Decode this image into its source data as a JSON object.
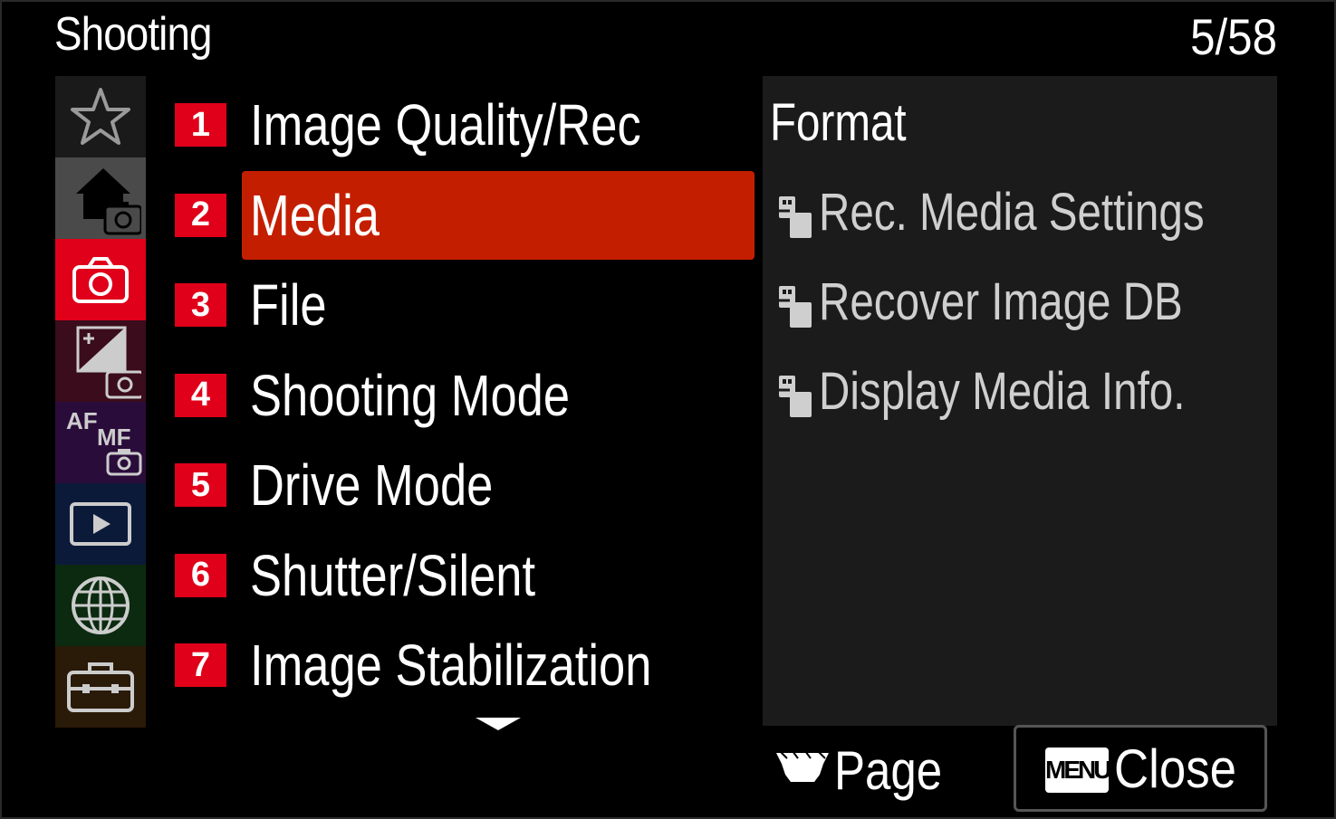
{
  "header": {
    "title": "Shooting",
    "page_indicator": "5/58"
  },
  "sidebar": {
    "categories": [
      {
        "name": "my-menu",
        "icon": "star-icon",
        "bg": "#1a1a1a"
      },
      {
        "name": "main-shooting",
        "icon": "home-camera-icon",
        "bg": "#4a4a4a"
      },
      {
        "name": "shooting",
        "icon": "camera-icon",
        "bg": "#e0001a",
        "selected": true
      },
      {
        "name": "exposure-color",
        "icon": "exposure-camera-icon",
        "bg": "#3a0c1c"
      },
      {
        "name": "focus",
        "icon": "af-mf-camera-icon",
        "bg": "#2a0c3a",
        "text_af": "AF",
        "text_mf": "MF"
      },
      {
        "name": "playback",
        "icon": "playback-icon",
        "bg": "#0c1a3a"
      },
      {
        "name": "network",
        "icon": "globe-icon",
        "bg": "#0c2a10"
      },
      {
        "name": "setup",
        "icon": "toolbox-icon",
        "bg": "#2a1a08"
      }
    ]
  },
  "menu": {
    "items": [
      {
        "number": "1",
        "label": "Image Quality/Rec"
      },
      {
        "number": "2",
        "label": "Media",
        "selected": true
      },
      {
        "number": "3",
        "label": "File"
      },
      {
        "number": "4",
        "label": "Shooting Mode"
      },
      {
        "number": "5",
        "label": "Drive Mode"
      },
      {
        "number": "6",
        "label": "Shutter/Silent"
      },
      {
        "number": "7",
        "label": "Image Stabilization"
      }
    ],
    "scroll_icon": "down-arrow-icon"
  },
  "sub_panel": {
    "items": [
      {
        "label": "Format",
        "icon": ""
      },
      {
        "label": "Rec. Media Settings",
        "icon": "media-slot-icon"
      },
      {
        "label": "Recover Image DB",
        "icon": "media-slot-icon"
      },
      {
        "label": "Display Media Info.",
        "icon": "media-slot-icon"
      }
    ]
  },
  "footer": {
    "page_label": "Page",
    "page_icon": "control-wheel-icon",
    "close_key": "MENU",
    "close_label": "Close"
  },
  "colors": {
    "highlight": "#c41e00",
    "badge": "#e0001a",
    "panel": "#1b1b1b"
  }
}
